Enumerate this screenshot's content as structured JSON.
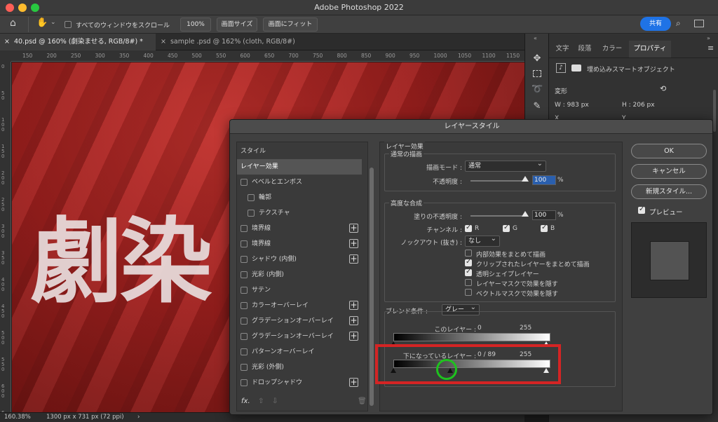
{
  "window": {
    "title": "Adobe Photoshop 2022"
  },
  "options_bar": {
    "scroll_all_label": "すべてのウィンドウをスクロール",
    "zoom_100": "100%",
    "fit_screen": "画面サイズ",
    "fill_screen": "画面にフィット",
    "share": "共有"
  },
  "tabs": [
    {
      "label": "40.psd @ 160% (劇染ませる, RGB/8#) *"
    },
    {
      "label": "sample .psd @ 162% (cloth, RGB/8#)"
    }
  ],
  "ruler": {
    "h": [
      "150",
      "200",
      "250",
      "300",
      "350",
      "400",
      "450",
      "500",
      "550",
      "600",
      "650",
      "700",
      "750",
      "800",
      "850",
      "900",
      "950",
      "1000",
      "1050",
      "1100",
      "1150"
    ],
    "v": [
      "0",
      "50",
      "100",
      "150",
      "200",
      "250",
      "300",
      "350",
      "400",
      "450",
      "500",
      "550",
      "600",
      "650"
    ]
  },
  "canvas": {
    "text": "劇染"
  },
  "status": {
    "zoom": "160.38%",
    "doc_size": "1300 px x 731 px (72 ppi)",
    "arrow": "›"
  },
  "panel": {
    "tabs": [
      "文字",
      "段落",
      "カラー",
      "プロパティ"
    ],
    "smart_object": "埋め込みスマートオブジェクト",
    "transform_label": "変形",
    "w": "W : 983 px",
    "h": "H : 206 px",
    "x_label": "X",
    "y_label": "Y"
  },
  "dialog": {
    "title": "レイヤースタイル",
    "styles_header": "スタイル",
    "style_items": [
      {
        "label": "レイヤー効果",
        "checkbox": false,
        "plus": false,
        "highlight": true,
        "indent": 0
      },
      {
        "label": "ベベルとエンボス",
        "checkbox": true,
        "plus": false,
        "indent": 0
      },
      {
        "label": "輪郭",
        "checkbox": true,
        "plus": false,
        "indent": 1
      },
      {
        "label": "テクスチャ",
        "checkbox": true,
        "plus": false,
        "indent": 1
      },
      {
        "label": "境界線",
        "checkbox": true,
        "plus": true,
        "indent": 0
      },
      {
        "label": "境界線",
        "checkbox": true,
        "plus": true,
        "indent": 0
      },
      {
        "label": "シャドウ (内側)",
        "checkbox": true,
        "plus": true,
        "indent": 0
      },
      {
        "label": "光彩 (内側)",
        "checkbox": true,
        "plus": false,
        "indent": 0
      },
      {
        "label": "サテン",
        "checkbox": true,
        "plus": false,
        "indent": 0
      },
      {
        "label": "カラーオーバーレイ",
        "checkbox": true,
        "plus": true,
        "indent": 0
      },
      {
        "label": "グラデーションオーバーレイ",
        "checkbox": true,
        "plus": true,
        "indent": 0
      },
      {
        "label": "グラデーションオーバーレイ",
        "checkbox": true,
        "plus": true,
        "indent": 0
      },
      {
        "label": "パターンオーバーレイ",
        "checkbox": true,
        "plus": false,
        "indent": 0
      },
      {
        "label": "光彩 (外側)",
        "checkbox": true,
        "plus": false,
        "indent": 0
      },
      {
        "label": "ドロップシャドウ",
        "checkbox": true,
        "plus": true,
        "indent": 0
      }
    ],
    "fx_label": "fx.",
    "main": {
      "section_title": "レイヤー効果",
      "normal": {
        "group": "通常の描画",
        "blend_mode_label": "描画モード :",
        "blend_mode_value": "通常",
        "opacity_label": "不透明度 :",
        "opacity_value": "100",
        "percent": "%"
      },
      "advanced": {
        "group": "高度な合成",
        "fill_label": "塗りの不透明度 :",
        "fill_value": "100",
        "percent": "%",
        "channels_label": "チャンネル :",
        "channels": [
          "R",
          "G",
          "B"
        ],
        "knockout_label": "ノックアウト (抜き) :",
        "knockout_value": "なし",
        "options": [
          {
            "label": "内部効果をまとめて描画",
            "checked": false
          },
          {
            "label": "クリップされたレイヤーをまとめて描画",
            "checked": true
          },
          {
            "label": "透明シェイプレイヤー",
            "checked": true
          },
          {
            "label": "レイヤーマスクで効果を隠す",
            "checked": false
          },
          {
            "label": "ベクトルマスクで効果を隠す",
            "checked": false
          }
        ]
      },
      "blend_if": {
        "label": "ブレンド条件 :",
        "value": "グレー",
        "this_layer_label": "このレイヤー :",
        "this_layer_low": "0",
        "this_layer_high": "255",
        "underlying_label": "下になっているレイヤー :",
        "underlying_low": "0 / 89",
        "underlying_high": "255"
      }
    },
    "buttons": {
      "ok": "OK",
      "cancel": "キャンセル",
      "new_style": "新規スタイル...",
      "preview": "プレビュー"
    }
  }
}
